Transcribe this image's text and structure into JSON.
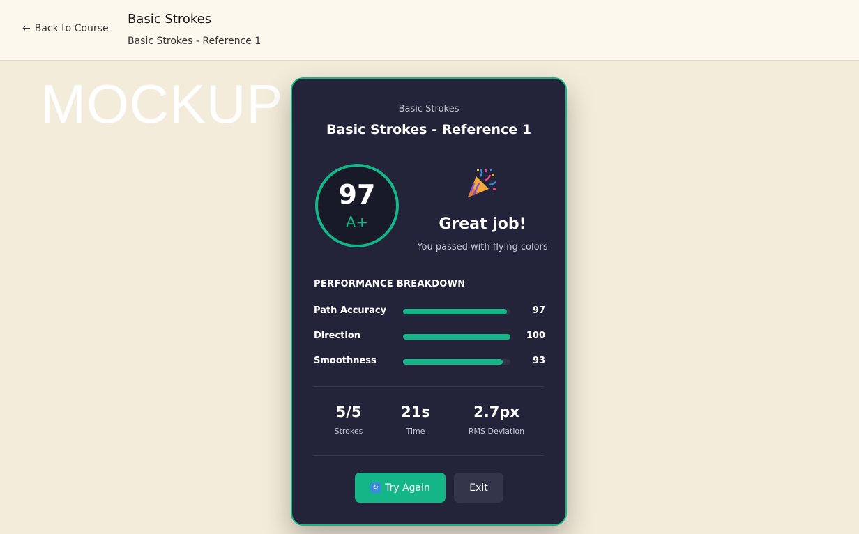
{
  "header": {
    "back_arrow": "←",
    "back_label": "Back to Course",
    "course_title": "Basic Strokes",
    "lesson_title": "Basic Strokes - Reference 1"
  },
  "watermark": "MOCKUP",
  "result": {
    "course": "Basic Strokes",
    "lesson": "Basic Strokes - Reference 1",
    "score": "97",
    "grade": "A+",
    "celebration_icon": "party-popper-icon",
    "headline": "Great job!",
    "message": "You passed with flying colors",
    "breakdown_title": "PERFORMANCE BREAKDOWN",
    "metrics": [
      {
        "label": "Path Accuracy",
        "value": "97",
        "percent": 97
      },
      {
        "label": "Direction",
        "value": "100",
        "percent": 100
      },
      {
        "label": "Smoothness",
        "value": "93",
        "percent": 93
      }
    ],
    "stats": [
      {
        "value": "5/5",
        "label": "Strokes"
      },
      {
        "value": "21s",
        "label": "Time"
      },
      {
        "value": "2.7px",
        "label": "RMS Deviation"
      }
    ],
    "try_again_label": "Try Again",
    "try_again_icon": "refresh-icon",
    "exit_label": "Exit"
  },
  "colors": {
    "accent": "#14b586",
    "card_bg": "#23243a",
    "page_bg": "#f4ecda",
    "header_bg": "#fcf8ee"
  }
}
